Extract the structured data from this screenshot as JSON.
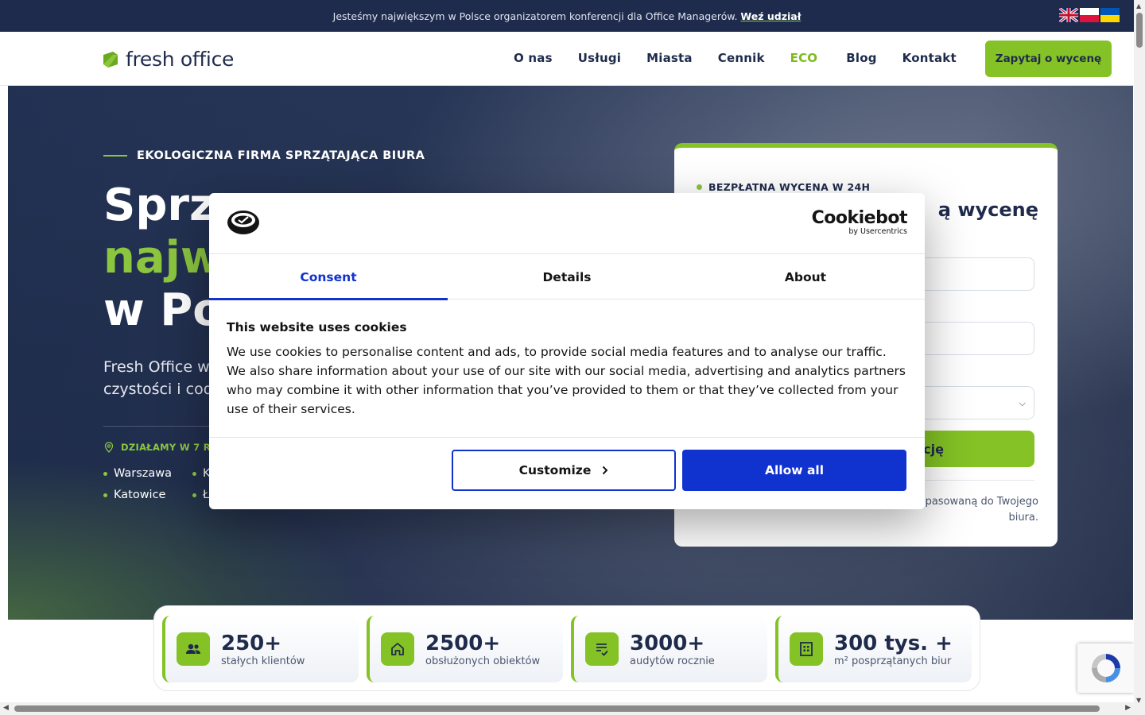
{
  "topbar": {
    "text": "Jesteśmy największym w Polsce organizatorem konferencji dla Office Managerów.",
    "link": "Weź udział"
  },
  "header": {
    "logo": "fresh office",
    "nav": [
      "O nas",
      "Usługi",
      "Miasta",
      "Cennik",
      "ECO",
      "Blog",
      "Kontakt"
    ],
    "eco_icon": "",
    "cta": "Zapytaj o wycenę"
  },
  "hero": {
    "eyebrow": "EKOLOGICZNA FIRMA SPRZĄTAJĄCA BIURA",
    "title_line1": "Sprzą",
    "title_line2": "najw",
    "title_line3": "w Po",
    "desc_line1": "Fresh Office w",
    "desc_line2": "czystości i cod",
    "regions": "DZIAŁAMY W 7 RE",
    "cities": [
      "Warszawa",
      "K",
      "Katowice",
      "Ł"
    ]
  },
  "form": {
    "eyebrow": "BEZPŁATNA WYCENA W 24H",
    "title": "ą wycenę",
    "submit": "cję",
    "note": "wizję lokalną i przygotować ofertę dopasowaną do Twojego biura."
  },
  "stats": [
    {
      "icon": "users-icon",
      "value": "250+",
      "label": "stałych klientów"
    },
    {
      "icon": "home-icon",
      "value": "2500+",
      "label": "obsłużonych obiektów"
    },
    {
      "icon": "checklist-icon",
      "value": "3000+",
      "label": "audytów rocznie"
    },
    {
      "icon": "building-icon",
      "value": "300 tys. +",
      "label": "m² posprzątanych biur"
    }
  ],
  "cookie": {
    "brand": "Cookiebot",
    "brand_sub": "by Usercentrics",
    "tabs": [
      "Consent",
      "Details",
      "About"
    ],
    "heading": "This website uses cookies",
    "body": "We use cookies to personalise content and ads, to provide social media features and to analyse our traffic. We also share information about your use of our site with our social media, advertising and analytics partners who may combine it with other information that you’ve provided to them or that they’ve collected from your use of their services.",
    "customize": "Customize",
    "allow_all": "Allow all"
  },
  "colors": {
    "navy": "#1f2b4d",
    "green": "#84c225",
    "cookie_blue": "#1032cf"
  }
}
